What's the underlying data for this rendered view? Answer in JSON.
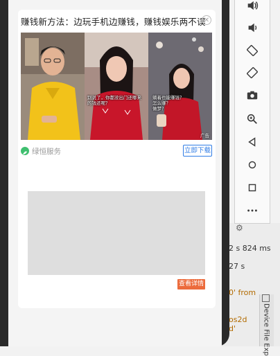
{
  "ad": {
    "title": "赚钱新方法：边玩手机边赚钱，赚钱娱乐两不误",
    "close_symbol": "✕",
    "image": {
      "subtitle_center_line1": "别说了，你都没出门还哪来",
      "subtitle_center_line2": "的钱还呢？",
      "subtitle_right_line1": "躺着也能赚钱？",
      "subtitle_right_line2": "怎么赚？",
      "subtitle_right_line3": "做梦？",
      "ad_tag": "广告"
    },
    "brand_name": "绿恒服务",
    "download_label": "立即下载",
    "detail_label": "查看详情"
  },
  "emulator_toolbar": {
    "icons": [
      "volume-up-icon",
      "volume-down-icon",
      "rotate-left-icon",
      "rotate-right-icon",
      "camera-icon",
      "zoom-icon",
      "back-icon",
      "home-icon",
      "overview-icon",
      "more-icon"
    ]
  },
  "ide": {
    "time_text": "2 s 824 ms",
    "line2": "27 s",
    "line3": "0' from",
    "line4": "os2d",
    "line5": "d'",
    "side_tab": "Device File Exp"
  }
}
